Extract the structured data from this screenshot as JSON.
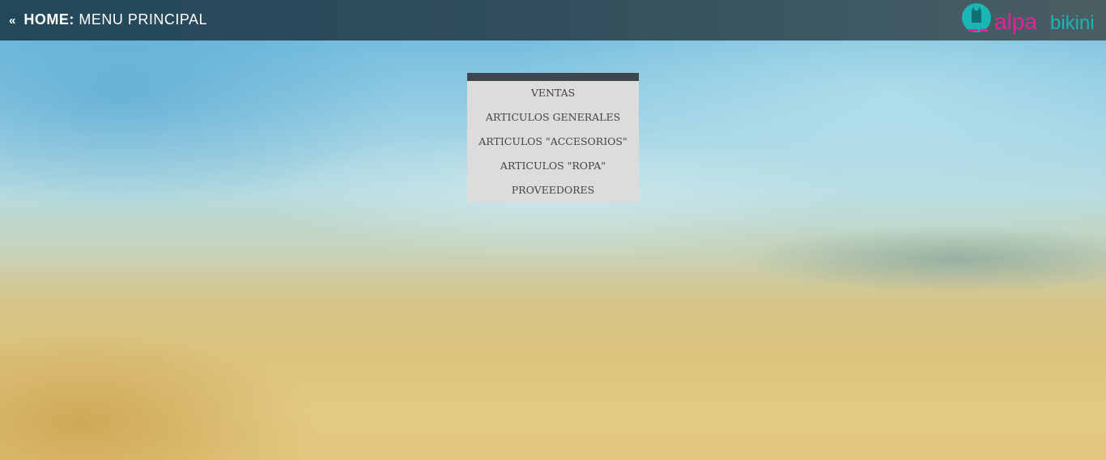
{
  "header": {
    "back_glyph": "«",
    "home_label": "HOME:",
    "page_title": "MENU PRINCIPAL",
    "logo": {
      "word_primary": "alpa",
      "word_secondary": "bikini",
      "primary_color": "#e0249a",
      "secondary_color": "#1bb5b5"
    }
  },
  "menu": {
    "items": [
      {
        "label": "VENTAS"
      },
      {
        "label": "ARTICULOS GENERALES"
      },
      {
        "label": "ARTICULOS \"ACCESORIOS\""
      },
      {
        "label": "ARTICULOS \"ROPA\""
      },
      {
        "label": "PROVEEDORES"
      }
    ]
  },
  "colors": {
    "header_bar": "#2f4d5c",
    "menu_header": "#3b4650",
    "menu_background": "#dcdcdc",
    "menu_text": "#444444"
  }
}
